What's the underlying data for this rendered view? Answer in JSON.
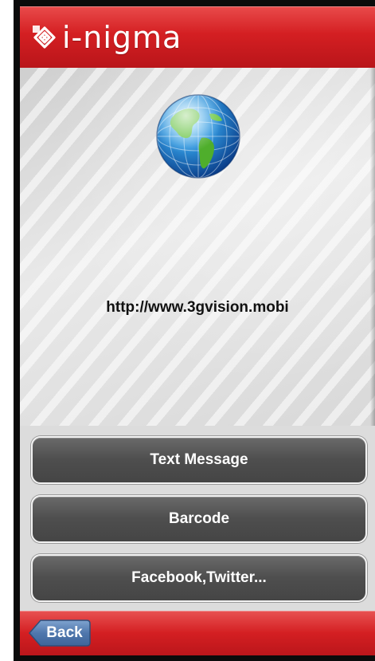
{
  "header": {
    "app_name": "i-nigma",
    "logo_icon": "i-nigma-logo-icon"
  },
  "content": {
    "icon": "globe-icon",
    "url": "http://www.3gvision.mobi"
  },
  "actions": [
    {
      "label": "Text Message"
    },
    {
      "label": "Barcode"
    },
    {
      "label": "Facebook,Twitter..."
    }
  ],
  "footer": {
    "back_label": "Back"
  },
  "colors": {
    "brand_red": "#d41f22",
    "button_gray": "#4e4e4e",
    "text_dark": "#111111"
  }
}
